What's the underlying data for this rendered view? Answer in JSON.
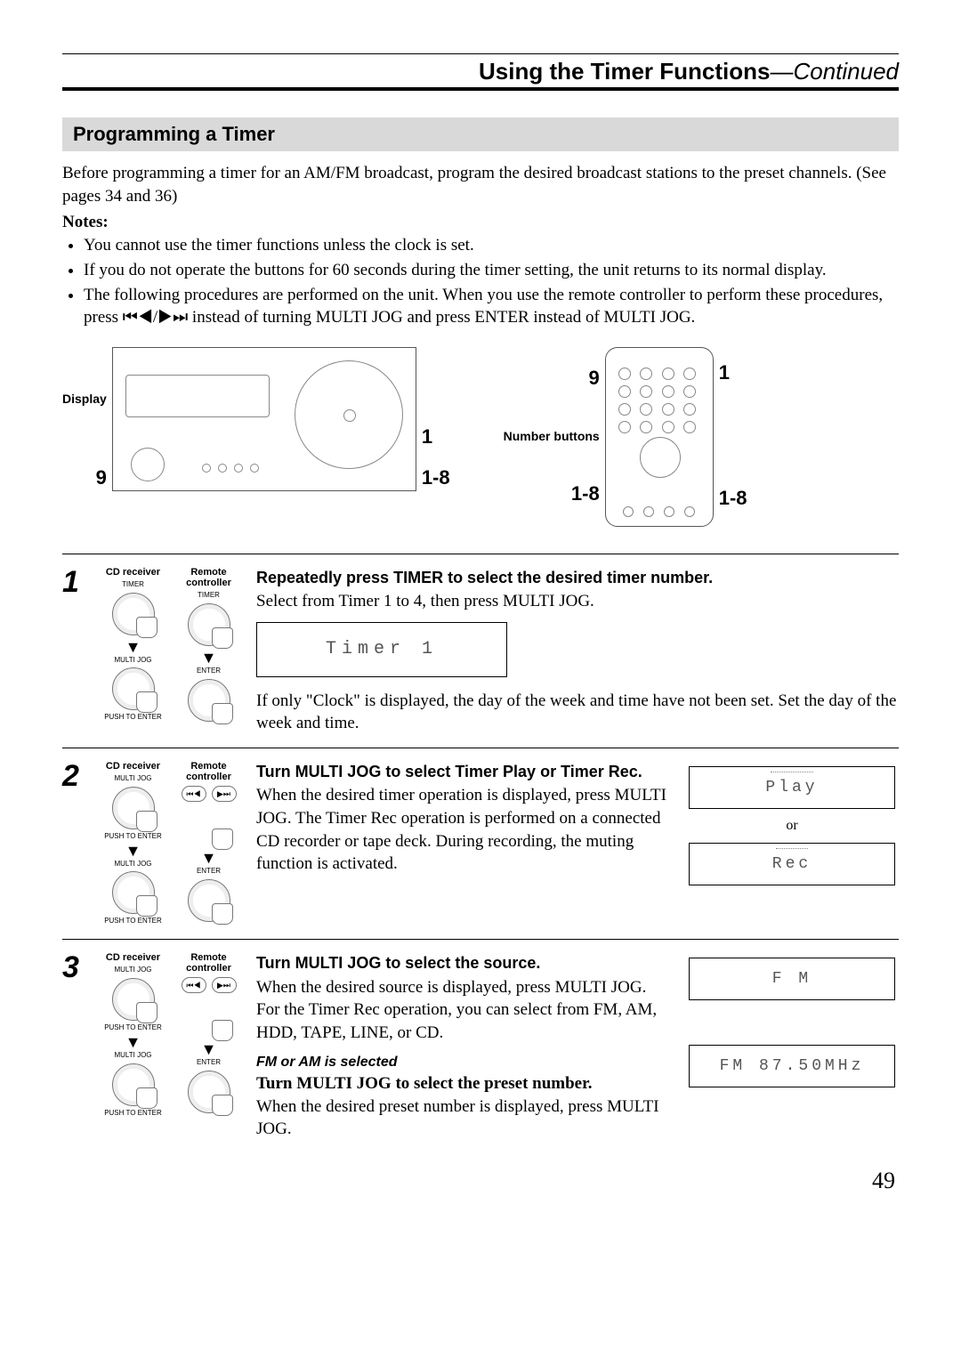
{
  "header": {
    "title_bold": "Using the Timer Functions",
    "title_light": "—Continued"
  },
  "section": {
    "heading": "Programming a Timer",
    "intro": "Before programming a timer for an AM/FM broadcast, program the desired broadcast stations to the preset channels. (See pages 34 and 36)",
    "notes_label": "Notes:",
    "notes": [
      "You cannot use the timer functions unless the clock is set.",
      "If you do not operate the buttons for 60 seconds during the timer setting, the unit returns to its normal display.",
      "The following procedures are performed on the unit. When you use the remote controller to perform these procedures, press ⏮◀/▶⏭ instead of turning MULTI JOG and press ENTER instead of MULTI JOG."
    ]
  },
  "diagram": {
    "display_label": "Display",
    "number_buttons_label": "Number buttons",
    "callout_1": "1",
    "callout_9": "9",
    "callout_1_8": "1-8"
  },
  "controls": {
    "cd_receiver": "CD receiver",
    "remote_controller": "Remote controller",
    "timer": "TIMER",
    "enter": "ENTER",
    "multi_jog": "MULTI JOG",
    "push_to_enter": "PUSH TO ENTER",
    "prev": "⏮◀",
    "next": "▶⏭"
  },
  "steps": [
    {
      "num": "1",
      "heading": "Repeatedly press TIMER to select the desired timer number.",
      "line1": "Select from Timer 1 to 4, then press MULTI JOG.",
      "lcd": "Timer  1",
      "line2": "If only \"Clock\" is displayed, the day of the week and time have not been set. Set the day of the week and time."
    },
    {
      "num": "2",
      "heading": "Turn MULTI JOG to select Timer Play or Timer Rec.",
      "body": "When the desired timer operation is displayed, press MULTI JOG. The Timer Rec operation is performed on a connected CD recorder or tape deck. During recording, the muting function is activated.",
      "disp_play": "Play",
      "disp_or": "or",
      "disp_rec": "Rec"
    },
    {
      "num": "3",
      "heading": "Turn MULTI JOG to select the source.",
      "body1": "When the desired source is displayed, press MULTI JOG.",
      "body2": "For the Timer Rec operation, you can select from FM, AM, HDD, TAPE, LINE, or CD.",
      "subhead": "FM or AM is selected",
      "bold_line": "Turn MULTI JOG to select the preset number.",
      "body3": "When the desired preset number is displayed, press MULTI JOG.",
      "disp_fm": "F M",
      "disp_freq": "FM  87.50MHz"
    }
  ],
  "page_number": "49"
}
